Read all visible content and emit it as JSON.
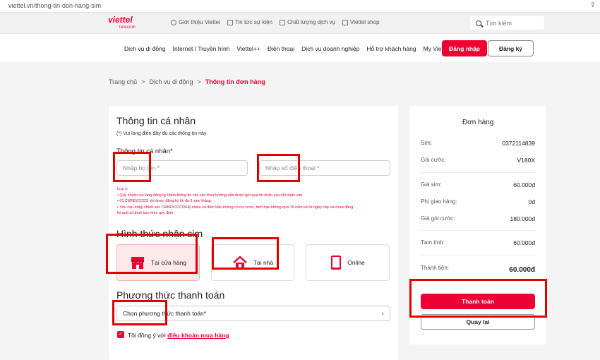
{
  "browser": {
    "url": "viettel.vn/thong-tin-don-hang-sim",
    "share_icon": "share-icon"
  },
  "header": {
    "logo_main": "viettel",
    "logo_sub": "telecom",
    "top_links": [
      {
        "label": "Giới thiệu Viettel",
        "icon": "globe-icon"
      },
      {
        "label": "Tin tức sự kiện",
        "icon": "news-icon"
      },
      {
        "label": "Chất lượng dịch vụ",
        "icon": "quality-icon"
      },
      {
        "label": "Viettel shop",
        "icon": "shop-icon"
      }
    ],
    "search_placeholder": "Tìm kiếm",
    "nav": [
      "Dịch vụ di động",
      "Internet / Truyền hình",
      "Viettel++",
      "Điện thoại",
      "Dịch vụ doanh nghiệp",
      "Hỗ trợ khách hàng",
      "My Viettel"
    ],
    "login": "Đăng nhập",
    "register": "Đăng ký"
  },
  "breadcrumb": {
    "home": "Trang chủ",
    "sep": ">",
    "section": "Dịch vụ di động",
    "current": "Thông tin đơn hàng"
  },
  "form": {
    "title": "Thông tin cá nhân",
    "required_note": "(*) Vui lòng điền đầy đủ các thông tin này",
    "personal_label": "Thông tin cá nhân*",
    "name_placeholder": "Nhập họ tên *",
    "phone_placeholder": "Nhập số điện thoại *",
    "notes": [
      "Lưu ý:",
      "• Quý khách vui lòng đăng ký thêm thông tin chủ sim theo hướng dẫn được gửi qua tin nhắn sau khi nhận sim",
      "• 01 CMND/CCCD chỉ được đăng ký tối đa 3 sim/ tháng",
      "• Yêu cầu nhập chính xác CMND/CCCD/Hộ chiếu và đảm bảo không có nợ cước, thời hạn không quá 15 năm kể từ ngày cấp và chưa đăng",
      "  ký quá số thuê bao theo quy định"
    ],
    "receive_title": "Hình thức nhận sim",
    "receive_options": [
      {
        "label": "Tại cửa hàng",
        "icon": "store-icon",
        "selected": true
      },
      {
        "label": "Tại nhà",
        "icon": "home-icon",
        "selected": false
      },
      {
        "label": "Online",
        "icon": "phone-icon",
        "selected": false
      }
    ],
    "payment_title": "Phương thức thanh toán",
    "payment_placeholder": "Chọn phương thức thanh toán*",
    "agree_text": "Tôi đồng ý với",
    "agree_link": "điều khoản mua hàng"
  },
  "order": {
    "title": "Đơn hàng",
    "sim_label": "Sim:",
    "sim_value": "0372114839",
    "plan_label": "Gói cước:",
    "plan_value": "V180X",
    "sim_price_label": "Giá sim:",
    "sim_price_value": "60.000đ",
    "shipping_label": "Phí giao hàng:",
    "shipping_value": "0đ",
    "plan_price_label": "Giá gói cước:",
    "plan_price_value": "180.000đ",
    "subtotal_label": "Tạm tính:",
    "subtotal_value": "60.000đ",
    "total_label": "Thành tiền:",
    "total_value": "60.000đ",
    "pay_button": "Thanh toán",
    "back_button": "Quay lại"
  },
  "colors": {
    "brand": "#ee0033",
    "highlight_box": "#e00000"
  }
}
